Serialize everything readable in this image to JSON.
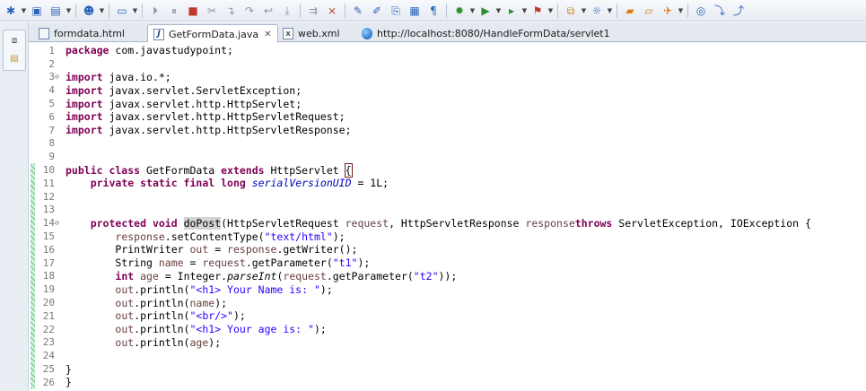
{
  "toolbar": {
    "items": [
      {
        "icon": "new-icon",
        "glyph": "✱",
        "drop": true
      },
      {
        "icon": "save-icon",
        "glyph": "▣"
      },
      {
        "icon": "save-all-icon",
        "glyph": "▤",
        "drop": true
      },
      {
        "sep": true
      },
      {
        "icon": "person-icon",
        "glyph": "☻",
        "drop": true
      },
      {
        "sep": true
      },
      {
        "icon": "terminal-icon",
        "glyph": "▭",
        "drop": true
      },
      {
        "sep": true
      },
      {
        "icon": "resume-icon",
        "glyph": "⏵"
      },
      {
        "icon": "suspend-icon",
        "glyph": "⏸"
      },
      {
        "icon": "terminate-icon",
        "glyph": "■"
      },
      {
        "icon": "disconnect-icon",
        "glyph": "✂"
      },
      {
        "icon": "step-into-icon",
        "glyph": "↴"
      },
      {
        "icon": "step-over-icon",
        "glyph": "↷"
      },
      {
        "icon": "step-return-icon",
        "glyph": "↩"
      },
      {
        "icon": "drop-frame-icon",
        "glyph": "⤓"
      },
      {
        "sep": true
      },
      {
        "icon": "use-step-filters-icon",
        "glyph": "⇉"
      },
      {
        "icon": "skip-breakpoints-icon",
        "glyph": "⨯"
      },
      {
        "sep": true
      },
      {
        "icon": "toggle-breakpoint-icon",
        "glyph": "✎"
      },
      {
        "icon": "mark-occurrences-icon",
        "glyph": "✐"
      },
      {
        "icon": "word-wrap-icon",
        "glyph": "⎘"
      },
      {
        "icon": "block-selection-icon",
        "glyph": "▦"
      },
      {
        "icon": "show-whitespace-icon",
        "glyph": "¶"
      },
      {
        "sep": true
      },
      {
        "icon": "debug-icon",
        "glyph": "✹",
        "drop": true
      },
      {
        "icon": "run-icon",
        "glyph": "▶",
        "drop": true
      },
      {
        "icon": "run-external-icon",
        "glyph": "▸",
        "drop": true
      },
      {
        "icon": "external-tools-icon",
        "glyph": "⚑",
        "drop": true
      },
      {
        "sep": true
      },
      {
        "icon": "new-server-icon",
        "glyph": "⧉",
        "drop": true
      },
      {
        "icon": "open-type-icon",
        "glyph": "☼",
        "drop": true
      },
      {
        "sep": true
      },
      {
        "icon": "open-folder-icon",
        "glyph": "▰"
      },
      {
        "icon": "open-project-icon",
        "glyph": "▱"
      },
      {
        "icon": "search-icon",
        "glyph": "✈",
        "drop": true
      },
      {
        "sep": true
      },
      {
        "icon": "web-browser-icon",
        "glyph": "◎"
      },
      {
        "icon": "next-annotation-icon",
        "glyph": "⤵"
      },
      {
        "icon": "previous-annotation-icon",
        "glyph": "⤴"
      }
    ]
  },
  "trim": {
    "buttons": [
      {
        "icon": "restore-icon",
        "glyph": "⧈"
      },
      {
        "icon": "package-explorer-icon",
        "glyph": "▤"
      }
    ]
  },
  "tabs": [
    {
      "label": "formdata.html",
      "icon": "html-file-icon",
      "kind": "file",
      "active": false,
      "close": false
    },
    {
      "label": "GetFormData.java",
      "icon": "java-file-icon",
      "kind": "java",
      "active": true,
      "close": true
    },
    {
      "label": "web.xml",
      "icon": "xml-file-icon",
      "kind": "xml",
      "active": false,
      "close": false
    },
    {
      "label": "http://localhost:8080/HandleFormData/servlet1",
      "icon": "browser-globe-icon",
      "kind": "globe",
      "active": false,
      "close": false
    }
  ],
  "editor": {
    "change_marks": [
      {
        "from": 10,
        "to": 26
      }
    ],
    "lines": [
      {
        "n": "1",
        "fold": "",
        "tokens": [
          [
            "kw",
            "package"
          ],
          [
            "",
            "com.javastudypoint;"
          ]
        ]
      },
      {
        "n": "2",
        "fold": "",
        "tokens": []
      },
      {
        "n": "3",
        "fold": "⊖",
        "tokens": [
          [
            "kw",
            "import"
          ],
          [
            "",
            "java.io.*;"
          ]
        ]
      },
      {
        "n": "4",
        "fold": "",
        "tokens": [
          [
            "kw",
            "import"
          ],
          [
            "",
            "javax.servlet.ServletException;"
          ]
        ]
      },
      {
        "n": "5",
        "fold": "",
        "tokens": [
          [
            "kw",
            "import"
          ],
          [
            "",
            "javax.servlet.http.HttpServlet;"
          ]
        ]
      },
      {
        "n": "6",
        "fold": "",
        "tokens": [
          [
            "kw",
            "import"
          ],
          [
            "",
            "javax.servlet.http.HttpServletRequest;"
          ]
        ]
      },
      {
        "n": "7",
        "fold": "",
        "tokens": [
          [
            "kw",
            "import"
          ],
          [
            "",
            "javax.servlet.http.HttpServletResponse;"
          ]
        ]
      },
      {
        "n": "8",
        "fold": "",
        "tokens": []
      },
      {
        "n": "9",
        "fold": "",
        "tokens": []
      },
      {
        "n": "10",
        "fold": "",
        "tokens": [
          [
            "kw",
            "public class"
          ],
          [
            "",
            " GetFormData "
          ],
          [
            "kw",
            "extends"
          ],
          [
            "",
            " HttpServlet "
          ],
          [
            "brk",
            "{"
          ]
        ]
      },
      {
        "n": "11",
        "fold": "",
        "tokens": [
          [
            "",
            "    "
          ],
          [
            "kw",
            "private static final long"
          ],
          [
            "",
            " "
          ],
          [
            "fld",
            "serialVersionUID"
          ],
          [
            "",
            " = 1L;"
          ]
        ]
      },
      {
        "n": "12",
        "fold": "",
        "tokens": []
      },
      {
        "n": "13",
        "fold": "",
        "tokens": []
      },
      {
        "n": "14",
        "fold": "⊖",
        "tokens": [
          [
            "",
            "    "
          ],
          [
            "kw",
            "protected void"
          ],
          [
            "",
            " "
          ],
          [
            "occ",
            "doPost"
          ],
          [
            "",
            "(HttpServletRequest "
          ],
          [
            "param",
            "request"
          ],
          [
            "",
            ", HttpServletResponse "
          ],
          [
            "param",
            "response"
          ],
          [
            ") "
          ],
          [
            "kw",
            "throws"
          ],
          [
            "",
            " ServletException, IOException {"
          ]
        ]
      },
      {
        "n": "15",
        "fold": "",
        "tokens": [
          [
            "",
            "        "
          ],
          [
            "param",
            "response"
          ],
          [
            "",
            ".setContentType("
          ],
          [
            "str",
            "\"text/html\""
          ],
          [
            "",
            ");"
          ]
        ]
      },
      {
        "n": "16",
        "fold": "",
        "tokens": [
          [
            "",
            "        PrintWriter "
          ],
          [
            "var",
            "out"
          ],
          [
            "",
            " = "
          ],
          [
            "param",
            "response"
          ],
          [
            "",
            ".getWriter();"
          ]
        ]
      },
      {
        "n": "17",
        "fold": "",
        "tokens": [
          [
            "",
            "        String "
          ],
          [
            "var",
            "name"
          ],
          [
            "",
            " = "
          ],
          [
            "param",
            "request"
          ],
          [
            "",
            ".getParameter("
          ],
          [
            "str",
            "\"t1\""
          ],
          [
            "",
            ");"
          ]
        ]
      },
      {
        "n": "18",
        "fold": "",
        "tokens": [
          [
            "",
            "        "
          ],
          [
            "kw",
            "int"
          ],
          [
            "",
            " "
          ],
          [
            "var",
            "age"
          ],
          [
            "",
            " = Integer."
          ],
          [
            "mth-it",
            "parseInt"
          ],
          [
            "",
            "("
          ],
          [
            "param",
            "request"
          ],
          [
            "",
            ".getParameter("
          ],
          [
            "str",
            "\"t2\""
          ],
          [
            "",
            "));"
          ]
        ]
      },
      {
        "n": "19",
        "fold": "",
        "tokens": [
          [
            "",
            "        "
          ],
          [
            "var",
            "out"
          ],
          [
            "",
            ".println("
          ],
          [
            "str",
            "\"<h1> Your Name is: \""
          ],
          [
            "",
            ");"
          ]
        ]
      },
      {
        "n": "20",
        "fold": "",
        "tokens": [
          [
            "",
            "        "
          ],
          [
            "var",
            "out"
          ],
          [
            "",
            ".println("
          ],
          [
            "var",
            "name"
          ],
          [
            "",
            ");"
          ]
        ]
      },
      {
        "n": "21",
        "fold": "",
        "tokens": [
          [
            "",
            "        "
          ],
          [
            "var",
            "out"
          ],
          [
            "",
            ".println("
          ],
          [
            "str",
            "\"<br/>\""
          ],
          [
            "",
            ");"
          ]
        ]
      },
      {
        "n": "22",
        "fold": "",
        "tokens": [
          [
            "",
            "        "
          ],
          [
            "var",
            "out"
          ],
          [
            "",
            ".println("
          ],
          [
            "str",
            "\"<h1> Your age is: \""
          ],
          [
            "",
            ");"
          ]
        ]
      },
      {
        "n": "23",
        "fold": "",
        "tokens": [
          [
            "",
            "        "
          ],
          [
            "var",
            "out"
          ],
          [
            "",
            ".println("
          ],
          [
            "var",
            "age"
          ],
          [
            "",
            ");"
          ]
        ]
      },
      {
        "n": "24",
        "fold": "",
        "tokens": []
      },
      {
        "n": "25",
        "fold": "",
        "tokens": [
          [
            "",
            "}"
          ]
        ]
      },
      {
        "n": "26",
        "fold": "",
        "tokens": [
          [
            "",
            "}"
          ]
        ]
      }
    ]
  }
}
